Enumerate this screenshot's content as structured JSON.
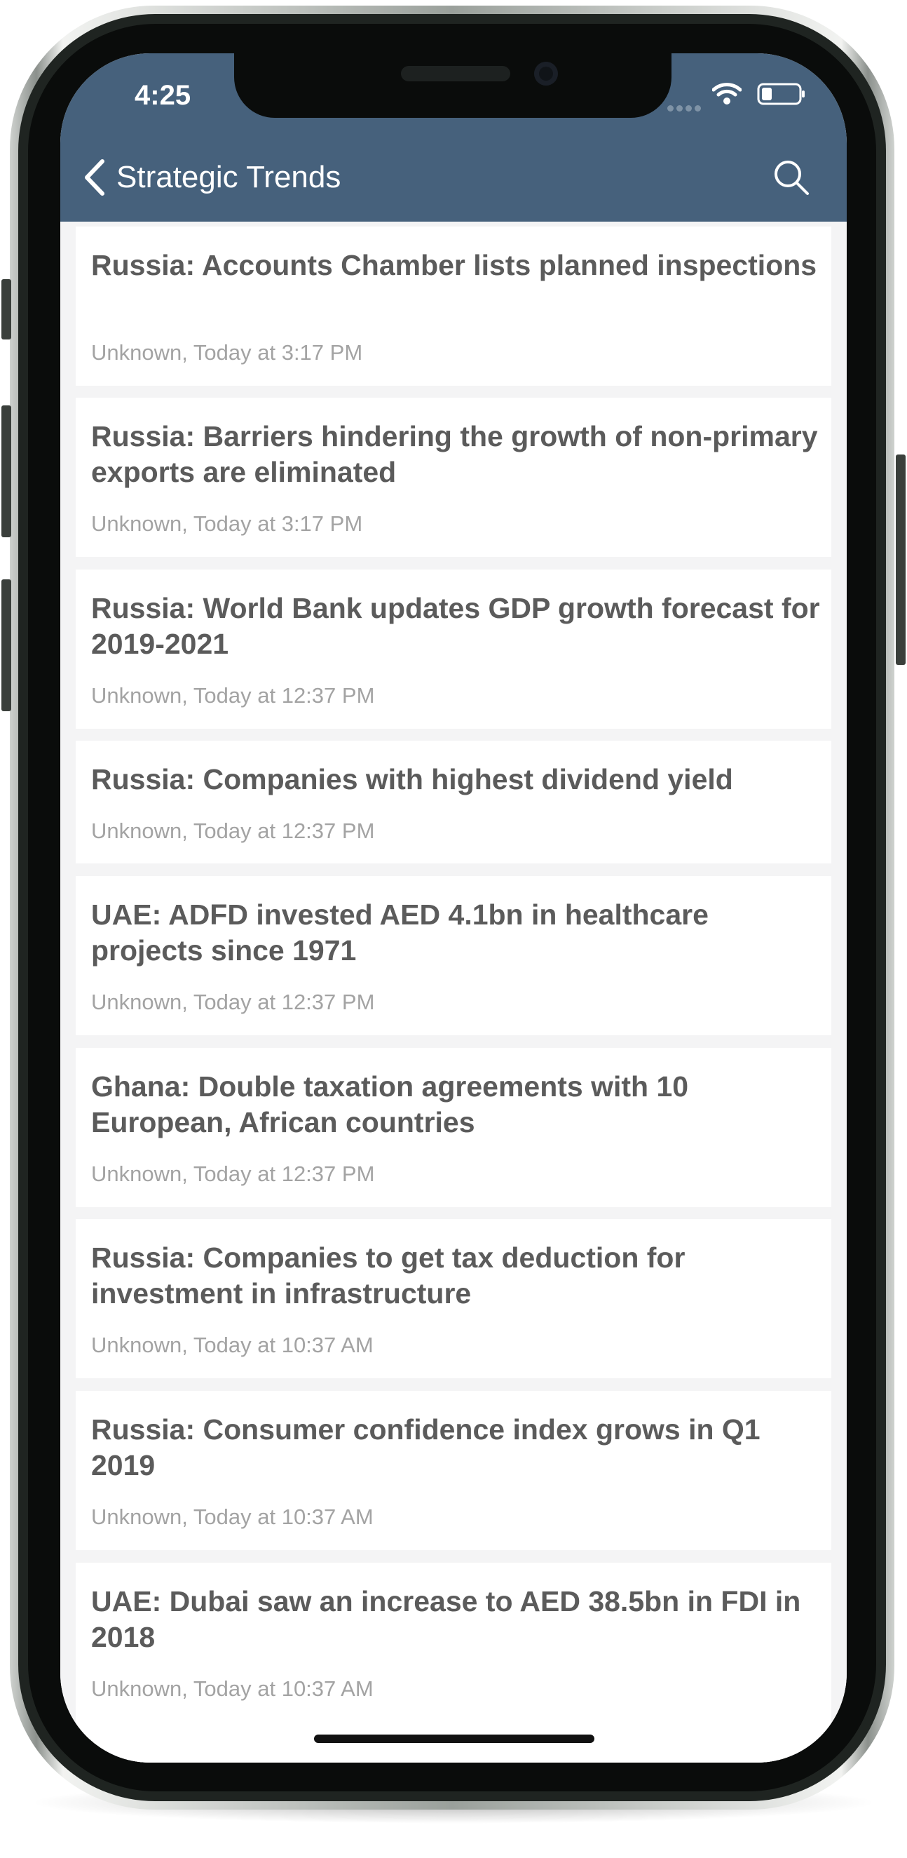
{
  "status_bar": {
    "time": "4:25"
  },
  "nav": {
    "title": "Strategic Trends"
  },
  "articles": [
    {
      "title": "Russia: Accounts Chamber lists planned inspections",
      "meta": "Unknown, Today at 3:17 PM"
    },
    {
      "title": "Russia: Barriers hindering the growth of non-primary exports are eliminated",
      "meta": "Unknown, Today at 3:17 PM"
    },
    {
      "title": "Russia: World Bank updates GDP growth forecast for 2019-2021",
      "meta": "Unknown, Today at 12:37 PM"
    },
    {
      "title": "Russia: Companies with highest dividend yield",
      "meta": "Unknown, Today at 12:37 PM"
    },
    {
      "title": "UAE: ADFD invested AED 4.1bn in healthcare projects since 1971",
      "meta": "Unknown, Today at 12:37 PM"
    },
    {
      "title": "Ghana: Double taxation agreements with 10 European, African countries",
      "meta": "Unknown, Today at 12:37 PM"
    },
    {
      "title": "Russia: Companies to get tax deduction for investment in infrastructure",
      "meta": "Unknown, Today at 10:37 AM"
    },
    {
      "title": "Russia: Consumer confidence index grows in Q1 2019",
      "meta": "Unknown, Today at 10:37 AM"
    },
    {
      "title": "UAE: Dubai saw an increase to AED 38.5bn in FDI in 2018",
      "meta": "Unknown, Today at 10:37 AM"
    }
  ],
  "colors": {
    "header": "#46617c",
    "list_background": "#f4f4f5",
    "title_text": "#5b5b5b",
    "meta_text": "#a3a3a3"
  },
  "icons": [
    "back-chevron-icon",
    "search-icon",
    "wifi-icon",
    "battery-icon"
  ]
}
